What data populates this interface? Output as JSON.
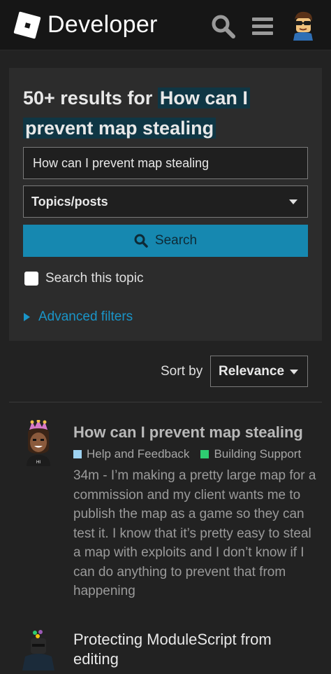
{
  "header": {
    "logo_text": "Developer",
    "icons": [
      "roblox-logo-icon",
      "search-icon",
      "hamburger-menu-icon",
      "user-avatar"
    ]
  },
  "search_panel": {
    "title_prefix": "50+ results for ",
    "title_query_line1": "How can I",
    "title_query_line2": "prevent map stealing",
    "input_value": "How can I prevent map stealing",
    "type_select": "Topics/posts",
    "search_button": "Search",
    "checkbox_label": "Search this topic",
    "checkbox_checked": false,
    "advanced_filters": "Advanced filters"
  },
  "sort": {
    "label": "Sort by",
    "value": "Relevance"
  },
  "results": [
    {
      "title": "How can I prevent map stealing",
      "categories": [
        {
          "name": "Help and Feedback",
          "color": "#9ed3f2"
        },
        {
          "name": "Building Support",
          "color": "#2ecc71"
        }
      ],
      "blurb": "34m - I’m making a pretty large map for a commission and my client wants me to publish the map as a game so they can test it. I know that it’s pretty easy to steal a map with exploits and I don’t know if I can do anything to prevent that from happening"
    },
    {
      "title": "Protecting ModuleScript from editing"
    }
  ],
  "colors": {
    "accent": "#1688b0",
    "link": "#1a95c8",
    "highlight": "#0f3644",
    "background": "#222222",
    "panel": "#2c2c2c"
  }
}
